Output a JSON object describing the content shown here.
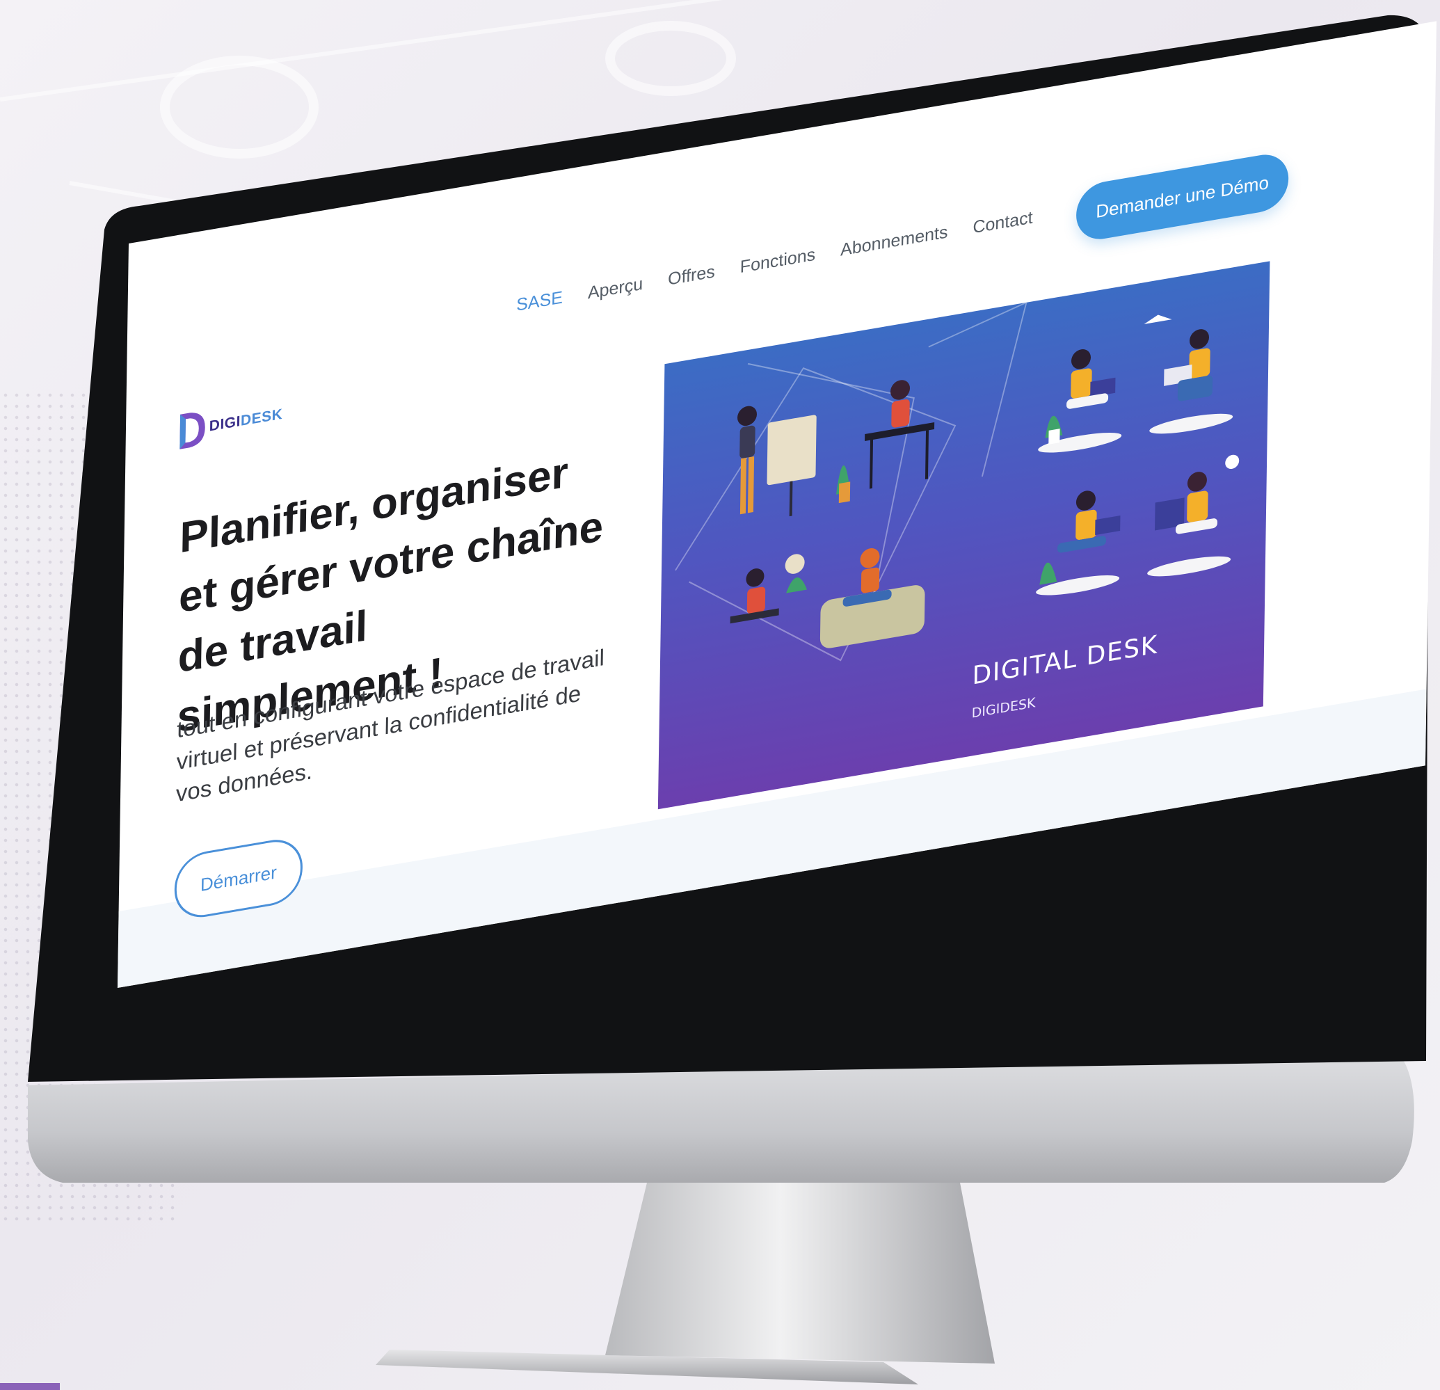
{
  "brand": {
    "name_part1": "DIGI",
    "name_part2": "DESK"
  },
  "nav": {
    "items": [
      {
        "label": "SASE",
        "active": true
      },
      {
        "label": "Aperçu",
        "active": false
      },
      {
        "label": "Offres",
        "active": false
      },
      {
        "label": "Fonctions",
        "active": false
      },
      {
        "label": "Abonnements",
        "active": false
      },
      {
        "label": "Contact",
        "active": false
      }
    ],
    "cta_label": "Demander une Démo"
  },
  "hero": {
    "headline": "Planifier, organiser et gérer votre chaîne de travail simplement !",
    "subtext": "tout en configurant votre espace de travail virtuel et préservant la confidentialité de vos données.",
    "start_label": "Démarrer",
    "image_title": "DIGITAL DESK",
    "image_subtitle": "DIGIDESK"
  },
  "colors": {
    "accent": "#3e97e0",
    "link_active": "#4a90d9",
    "headline": "#1c1c1f",
    "hero_gradient_top": "#3c6cc4",
    "hero_gradient_bottom": "#6b3fae",
    "brand_purple": "#3b2f8a"
  },
  "icons": [
    "digidesk-logo-icon",
    "webcam-icon"
  ]
}
